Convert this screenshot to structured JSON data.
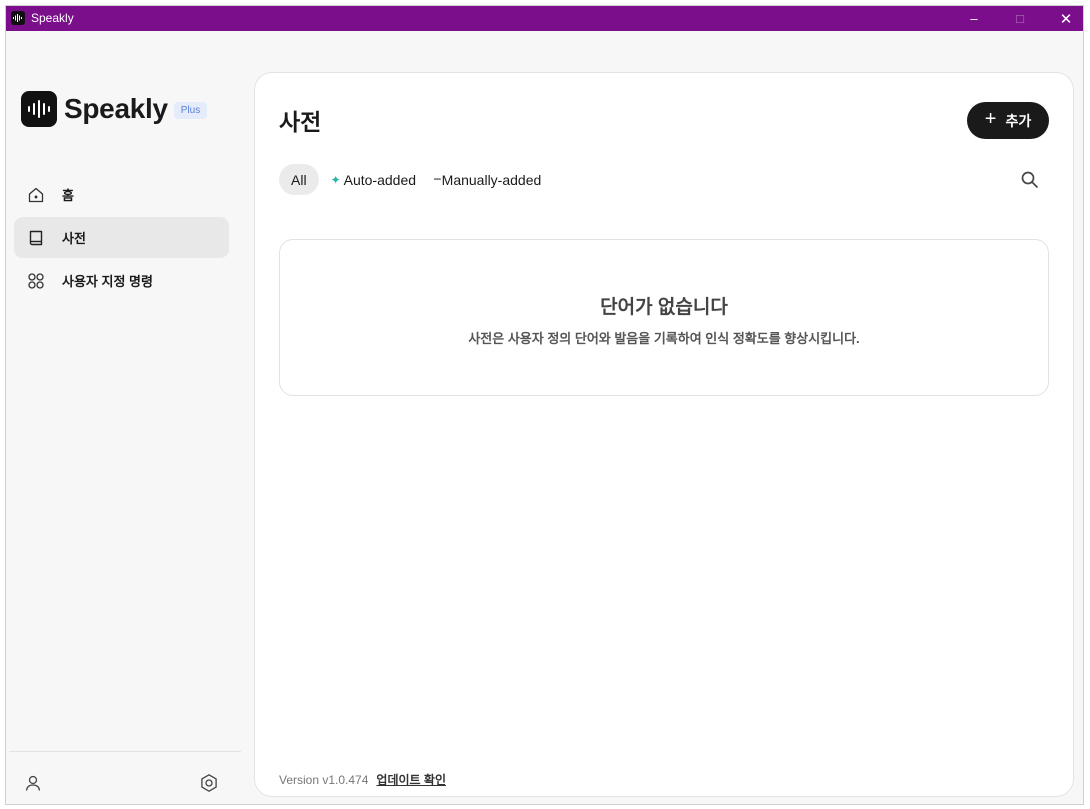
{
  "window": {
    "title": "Speakly",
    "controls": {
      "minimize": "–",
      "maximize": "□",
      "close": "✕"
    },
    "titlebar_color": "#7b0e8b"
  },
  "sidebar": {
    "logo_text": "Speakly",
    "plan_badge": "Plus",
    "items": [
      {
        "label": "홈",
        "icon": "home-icon",
        "active": false
      },
      {
        "label": "사전",
        "icon": "book-icon",
        "active": true
      },
      {
        "label": "사용자 지정 명령",
        "icon": "commands-grid-icon",
        "active": false
      }
    ],
    "footer": {
      "left_icon": "user-icon",
      "right_icon": "settings-icon"
    }
  },
  "main": {
    "title": "사전",
    "add_button": {
      "label": "추가",
      "icon": "plus-icon"
    },
    "filters": [
      {
        "label": "All",
        "selected": true
      },
      {
        "label": "Auto-added",
        "icon": "sparkle-icon",
        "icon_color": "#23b5a5",
        "selected": false
      },
      {
        "label": "Manually-added",
        "icon": "dash-icon",
        "selected": false
      }
    ],
    "search_icon": "search-icon",
    "empty_state": {
      "title": "단어가 없습니다",
      "description": "사전은 사용자 정의 단어와 발음을 기록하여 인식 정확도를 향상시킵니다."
    },
    "version_text": "Version v1.0.474",
    "update_link": "업데이트 확인"
  }
}
